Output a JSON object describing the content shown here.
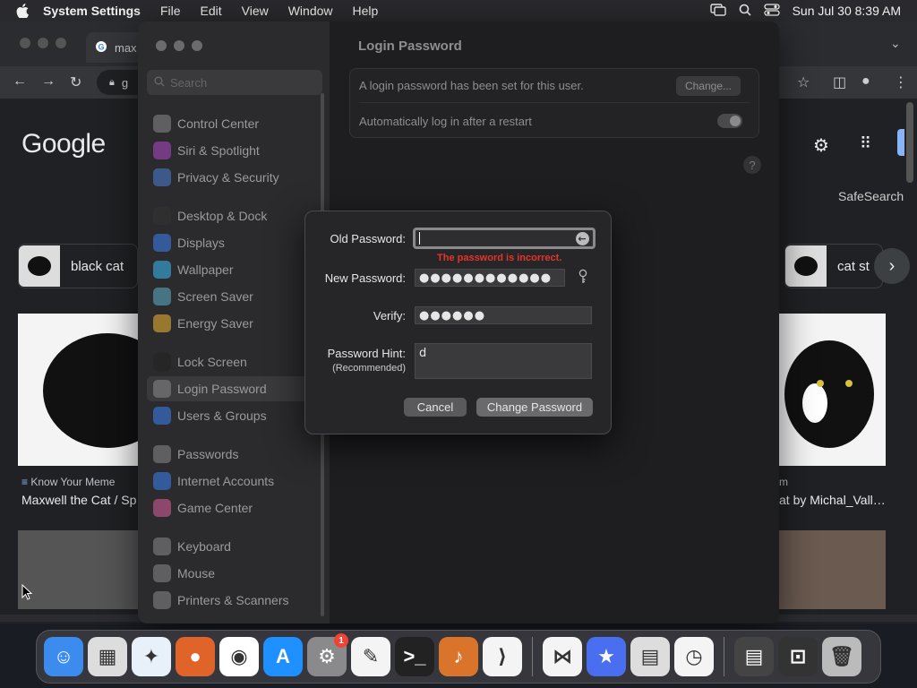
{
  "menubar": {
    "app": "System Settings",
    "menus": [
      "File",
      "Edit",
      "View",
      "Window",
      "Help"
    ],
    "clock": "Sun Jul 30  8:39 AM"
  },
  "browser": {
    "tab_title": "max",
    "url": "g",
    "logo": "Google",
    "safesearch": "SafeSearch",
    "chips": [
      "black cat",
      "cat st"
    ],
    "cards": [
      {
        "source": "Know Your Meme",
        "title": "Maxwell the Cat / Sp"
      },
      {
        "source": "m",
        "title": "at by Michal_Vall…"
      }
    ]
  },
  "settings": {
    "search_placeholder": "Search",
    "sidebar_groups": [
      [
        {
          "label": "Control Center",
          "icon": "control-center-icon",
          "color": "#8a8a8c"
        },
        {
          "label": "Siri & Spotlight",
          "icon": "siri-icon",
          "color": "#b048c8"
        },
        {
          "label": "Privacy & Security",
          "icon": "hand-icon",
          "color": "#4a7fd6"
        }
      ],
      [
        {
          "label": "Desktop & Dock",
          "icon": "dock-icon",
          "color": "#333333"
        },
        {
          "label": "Displays",
          "icon": "sun-icon",
          "color": "#3b82f6"
        },
        {
          "label": "Wallpaper",
          "icon": "wallpaper-icon",
          "color": "#38bdf8"
        },
        {
          "label": "Screen Saver",
          "icon": "screensaver-icon",
          "color": "#5fb0c8"
        },
        {
          "label": "Energy Saver",
          "icon": "battery-icon",
          "color": "#f2b632"
        }
      ],
      [
        {
          "label": "Lock Screen",
          "icon": "lock-icon",
          "color": "#222222"
        },
        {
          "label": "Login Password",
          "icon": "password-icon",
          "color": "#8a8a8c",
          "selected": true
        },
        {
          "label": "Users & Groups",
          "icon": "users-icon",
          "color": "#3b82f6"
        }
      ],
      [
        {
          "label": "Passwords",
          "icon": "key-icon",
          "color": "#8a8a8c"
        },
        {
          "label": "Internet Accounts",
          "icon": "at-icon",
          "color": "#3b82f6"
        },
        {
          "label": "Game Center",
          "icon": "game-center-icon",
          "color": "#e05fa0"
        }
      ],
      [
        {
          "label": "Keyboard",
          "icon": "keyboard-icon",
          "color": "#8a8a8c"
        },
        {
          "label": "Mouse",
          "icon": "mouse-icon",
          "color": "#8a8a8c"
        },
        {
          "label": "Printers & Scanners",
          "icon": "printer-icon",
          "color": "#8a8a8c"
        }
      ]
    ],
    "content_title": "Login Password",
    "rows": {
      "status": "A login password has been set for this user.",
      "change_label": "Change...",
      "autologin": "Automatically log in after a restart"
    },
    "help": "?"
  },
  "dialog": {
    "old_label": "Old Password:",
    "old_value": "",
    "error": "The password is incorrect.",
    "new_label": "New Password:",
    "new_value": "●●●●●●●●●●●●",
    "verify_label": "Verify:",
    "verify_value": "●●●●●●",
    "hint_label": "Password Hint:",
    "hint_sub": "(Recommended)",
    "hint_value": "d",
    "cancel": "Cancel",
    "submit": "Change Password"
  },
  "dock": [
    {
      "name": "finder-icon",
      "bg": "#3c8cf0",
      "glyph": "☺"
    },
    {
      "name": "launchpad-icon",
      "bg": "#ddd",
      "glyph": "▦"
    },
    {
      "name": "safari-icon",
      "bg": "#e8f0fa",
      "glyph": "✦"
    },
    {
      "name": "firefox-icon",
      "bg": "#e0642a",
      "glyph": "●"
    },
    {
      "name": "chrome-icon",
      "bg": "#ffffff",
      "glyph": "◉"
    },
    {
      "name": "app-store-icon",
      "bg": "#1e90ff",
      "glyph": "A"
    },
    {
      "name": "system-settings-icon",
      "bg": "#8a8a8c",
      "glyph": "⚙",
      "badge": "1"
    },
    {
      "name": "textedit-icon",
      "bg": "#f4f4f4",
      "glyph": "✎"
    },
    {
      "name": "terminal-icon",
      "bg": "#222222",
      "glyph": ">_"
    },
    {
      "name": "garageband-icon",
      "bg": "#d9742a",
      "glyph": "♪"
    },
    {
      "name": "vscode-icon",
      "bg": "#f4f4f4",
      "glyph": "⟩"
    },
    {
      "sep": true
    },
    {
      "name": "visual-studio-icon",
      "bg": "#f4f4f4",
      "glyph": "⋈"
    },
    {
      "name": "reeder-icon",
      "bg": "#4a6ef0",
      "glyph": "★"
    },
    {
      "name": "calculator-icon",
      "bg": "#dddddd",
      "glyph": "▤"
    },
    {
      "name": "clock-icon",
      "bg": "#f4f4f4",
      "glyph": "◷"
    },
    {
      "sep": true
    },
    {
      "name": "calculator-widget-icon",
      "bg": "#444444",
      "glyph": "▤"
    },
    {
      "name": "screenshot-icon",
      "bg": "#333333",
      "glyph": "⊡"
    },
    {
      "name": "trash-icon",
      "bg": "#bbbbbb",
      "glyph": "🗑"
    }
  ]
}
